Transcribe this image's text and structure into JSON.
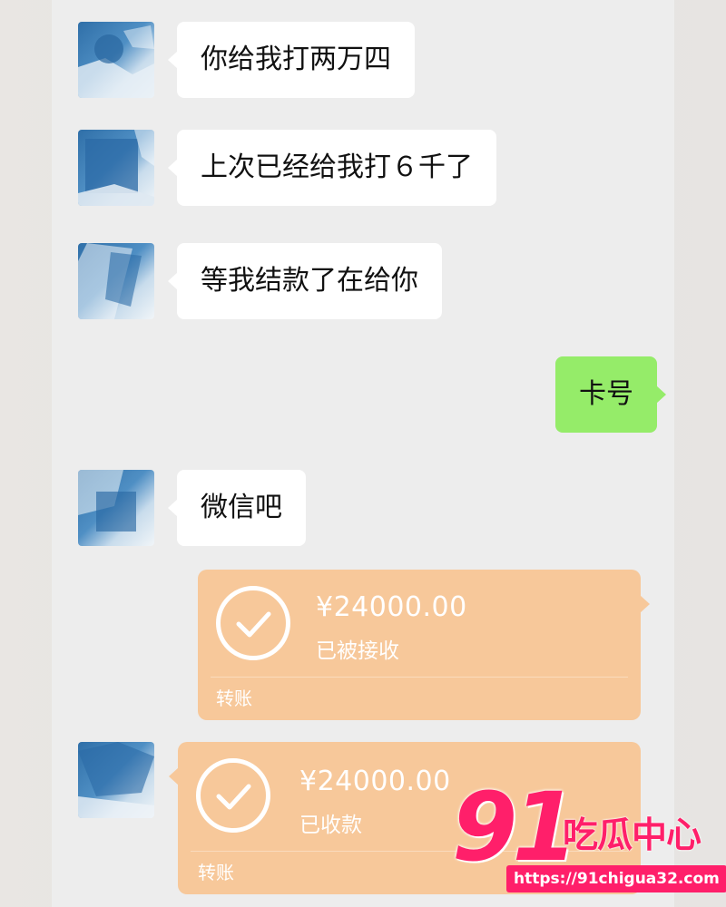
{
  "chat": {
    "messages": [
      {
        "side": "left",
        "text": "你给我打两万四"
      },
      {
        "side": "left",
        "text": "上次已经给我打６千了"
      },
      {
        "side": "left",
        "text": "等我结款了在给你"
      },
      {
        "side": "right",
        "text": "卡号"
      },
      {
        "side": "left",
        "text": "微信吧"
      }
    ],
    "transfers": [
      {
        "side": "right",
        "amount": "¥24000.00",
        "status": "已被接收",
        "label": "转账"
      },
      {
        "side": "left",
        "amount": "¥24000.00",
        "status": "已收款",
        "label": "转账"
      }
    ]
  },
  "colors": {
    "chat_bg": "#ededed",
    "bubble_left": "#ffffff",
    "bubble_right": "#95ec69",
    "transfer_bg": "#f7c89a",
    "watermark": "#ff1f6a"
  },
  "icons": {
    "avatar": "avatar-image",
    "transfer": "check-circle-icon"
  },
  "watermark": {
    "number": "91",
    "name": "吃瓜中心",
    "url": "https://91chigua32.com"
  }
}
